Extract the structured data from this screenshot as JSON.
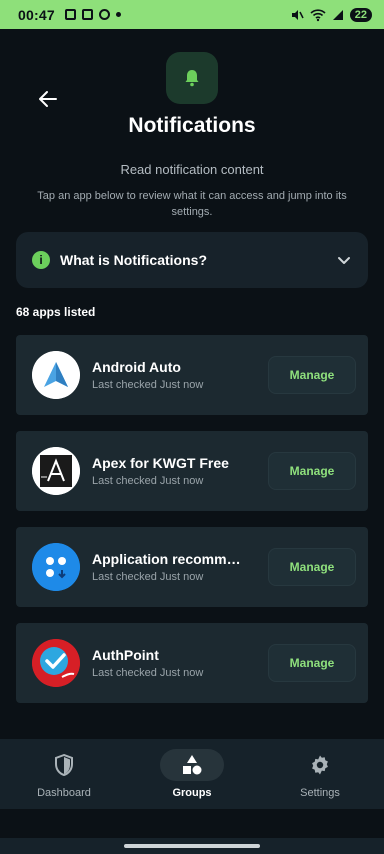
{
  "status_bar": {
    "time": "00:47",
    "battery": "22"
  },
  "header": {
    "title": "Notifications",
    "subtitle": "Read notification content",
    "description": "Tap an app below to review what it can access and jump into its settings."
  },
  "faq": {
    "label": "What is Notifications?"
  },
  "list": {
    "count": "68 apps listed",
    "apps": [
      {
        "name": "Android Auto",
        "meta": "Last checked Just now",
        "action": "Manage",
        "icon": "android-auto-icon"
      },
      {
        "name": "Apex for KWGT Free",
        "meta": "Last checked Just now",
        "action": "Manage",
        "icon": "apex-kwgt-icon"
      },
      {
        "name": "Application recomme…",
        "meta": "Last checked Just now",
        "action": "Manage",
        "icon": "app-recommendation-icon"
      },
      {
        "name": "AuthPoint",
        "meta": "Last checked Just now",
        "action": "Manage",
        "icon": "authpoint-icon"
      }
    ]
  },
  "nav": {
    "items": [
      {
        "label": "Dashboard",
        "icon": "shield-icon",
        "active": false
      },
      {
        "label": "Groups",
        "icon": "shapes-icon",
        "active": true
      },
      {
        "label": "Settings",
        "icon": "gear-icon",
        "active": false
      }
    ]
  },
  "colors": {
    "accent": "#8ee07a",
    "background": "#0b1116",
    "card": "#1c2930"
  }
}
